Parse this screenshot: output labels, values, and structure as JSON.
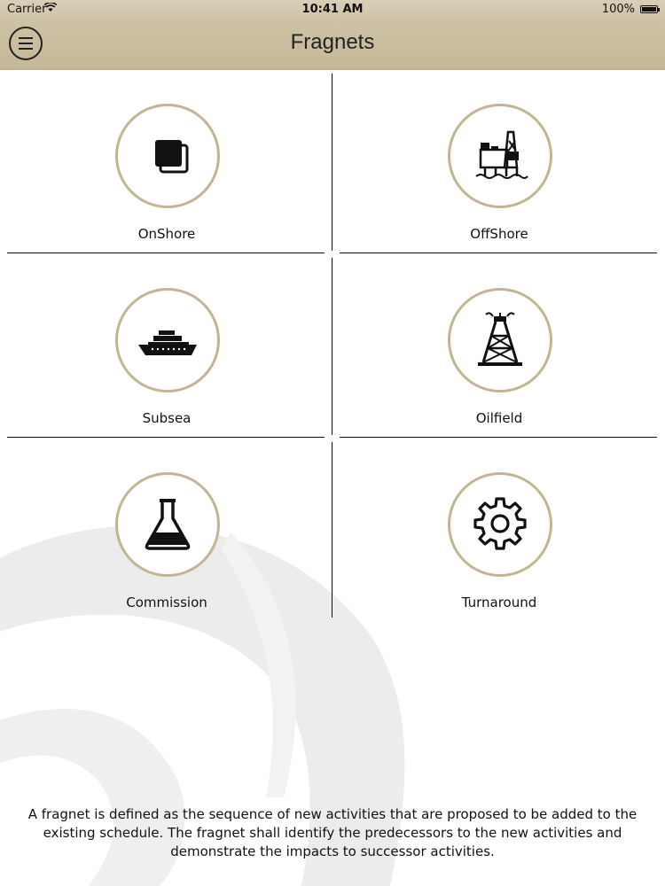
{
  "status_bar": {
    "carrier": "Carrier",
    "time": "10:41 AM",
    "battery": "100%"
  },
  "nav": {
    "title": "Fragnets",
    "menu_icon": "hamburger-menu-icon"
  },
  "tiles": [
    {
      "label": "OnShore",
      "icon": "stacked-squares-icon"
    },
    {
      "label": "OffShore",
      "icon": "offshore-platform-icon"
    },
    {
      "label": "Subsea",
      "icon": "ship-icon"
    },
    {
      "label": "Oilfield",
      "icon": "oil-derrick-icon"
    },
    {
      "label": "Commission",
      "icon": "flask-icon"
    },
    {
      "label": "Turnaround",
      "icon": "gear-icon"
    }
  ],
  "description": "A fragnet is defined as the sequence of new activities that are proposed to be added to the existing schedule. The fragnet shall identify the predecessors to the new activities and demonstrate the impacts to successor activities.",
  "colors": {
    "header": "#c8bd9f",
    "circle_border": "#c2b593"
  }
}
